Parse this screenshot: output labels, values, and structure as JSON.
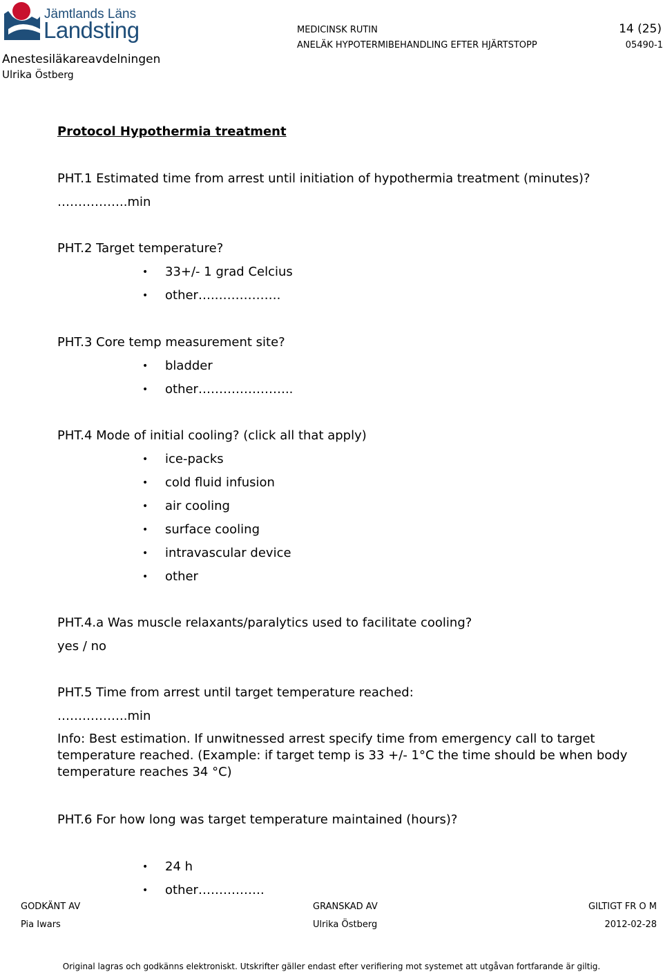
{
  "header": {
    "logo": {
      "line1": "Jämtlands Läns",
      "line2": "Landsting",
      "colors": {
        "red": "#c8102e",
        "blue": "#1f4e79"
      }
    },
    "department": "Anestesiläkareavdelningen",
    "author_first": "Ulrika",
    "author_last": "Östberg",
    "doc_type": "MEDICINSK RUTIN",
    "doc_title": "ANELÄK HYPOTERMIBEHANDLING EFTER HJÄRTSTOPP",
    "page": "14 (25)",
    "doc_number": "05490-1"
  },
  "content": {
    "title": "Protocol Hypothermia treatment",
    "pht1": {
      "question": "PHT.1 Estimated time from arrest until initiation of hypothermia treatment (minutes)?",
      "answer": "……………..min"
    },
    "pht2": {
      "question": "PHT.2 Target temperature?",
      "options": [
        "33+/- 1 grad Celcius",
        "other….……………."
      ]
    },
    "pht3": {
      "question": "PHT.3 Core temp measurement site?",
      "options": [
        "bladder",
        "other………………….."
      ]
    },
    "pht4": {
      "question": "PHT.4 Mode of initial cooling? (click all that apply)",
      "options": [
        "ice-packs",
        "cold fluid infusion",
        "air cooling",
        "surface cooling",
        "intravascular device",
        "other"
      ]
    },
    "pht4a": {
      "question": "PHT.4.a Was muscle relaxants/paralytics used to facilitate cooling?",
      "answer": "yes / no"
    },
    "pht5": {
      "question": "PHT.5 Time from arrest until target temperature reached:",
      "answer": "……………..min",
      "info": "Info: Best estimation. If unwitnessed arrest specify time from emergency call to target temperature reached. (Example: if target temp is 33 +/- 1°C the time should be when body temperature reaches 34 °C)"
    },
    "pht6": {
      "question": "PHT.6 For how long was target temperature maintained (hours)?",
      "options": [
        "24 h",
        "other……………."
      ]
    }
  },
  "footer": {
    "approved_label": "GODKÄNT AV",
    "approved_value": "Pia Iwars",
    "reviewed_label": "GRANSKAD AV",
    "reviewed_value": "Ulrika Östberg",
    "valid_label": "GILTIGT FR O M",
    "valid_value": "2012-02-28",
    "disclaimer": "Original lagras och godkänns elektroniskt. Utskrifter gäller endast efter verifiering mot systemet att utgåvan fortfarande är giltig."
  },
  "bullet_glyph": "•"
}
